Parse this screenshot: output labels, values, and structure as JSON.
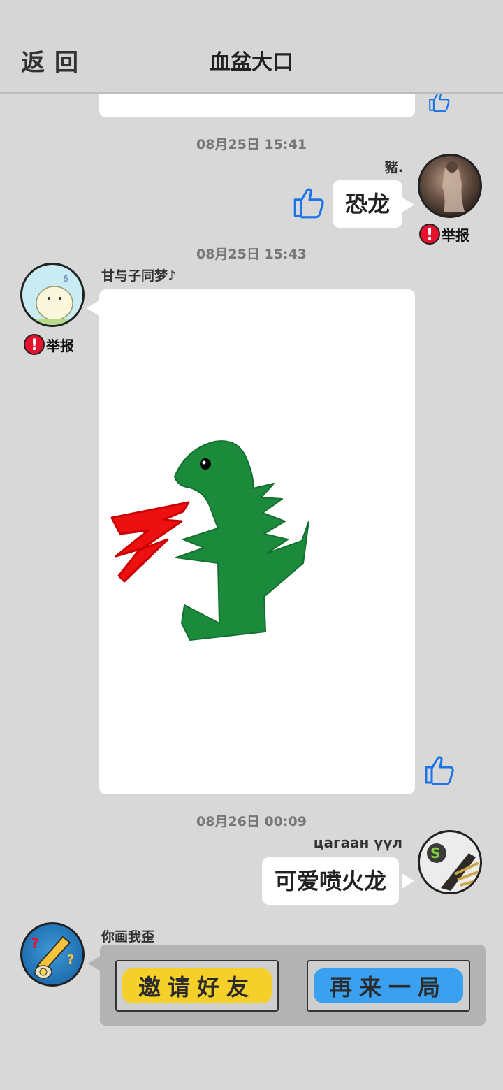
{
  "header": {
    "back_label": "返回",
    "title": "血盆大口"
  },
  "messages": [
    {
      "time": "08月25日  15:41",
      "nickname": "豬.",
      "text": "恐龙",
      "report_label": "举报"
    },
    {
      "time": "08月25日  15:43",
      "nickname": "甘与子同梦♪",
      "report_label": "举报"
    },
    {
      "time": "08月26日  00:09",
      "nickname": "цагаан үүл",
      "text": "可爱喷火龙"
    }
  ],
  "game_card": {
    "nickname": "你画我歪",
    "invite_label": "邀请好友",
    "again_label": "再来一局"
  },
  "colors": {
    "background": "#d8d8d8",
    "report_red": "#e8112d",
    "like_blue": "#1a73e8",
    "invite_yellow": "#f5cf2a",
    "again_blue": "#3aa0f0",
    "dino_green": "#1b8a3a",
    "fire_red": "#ec1010"
  },
  "icons": [
    "thumbs-up-icon",
    "warning-icon",
    "pencil-icon"
  ]
}
